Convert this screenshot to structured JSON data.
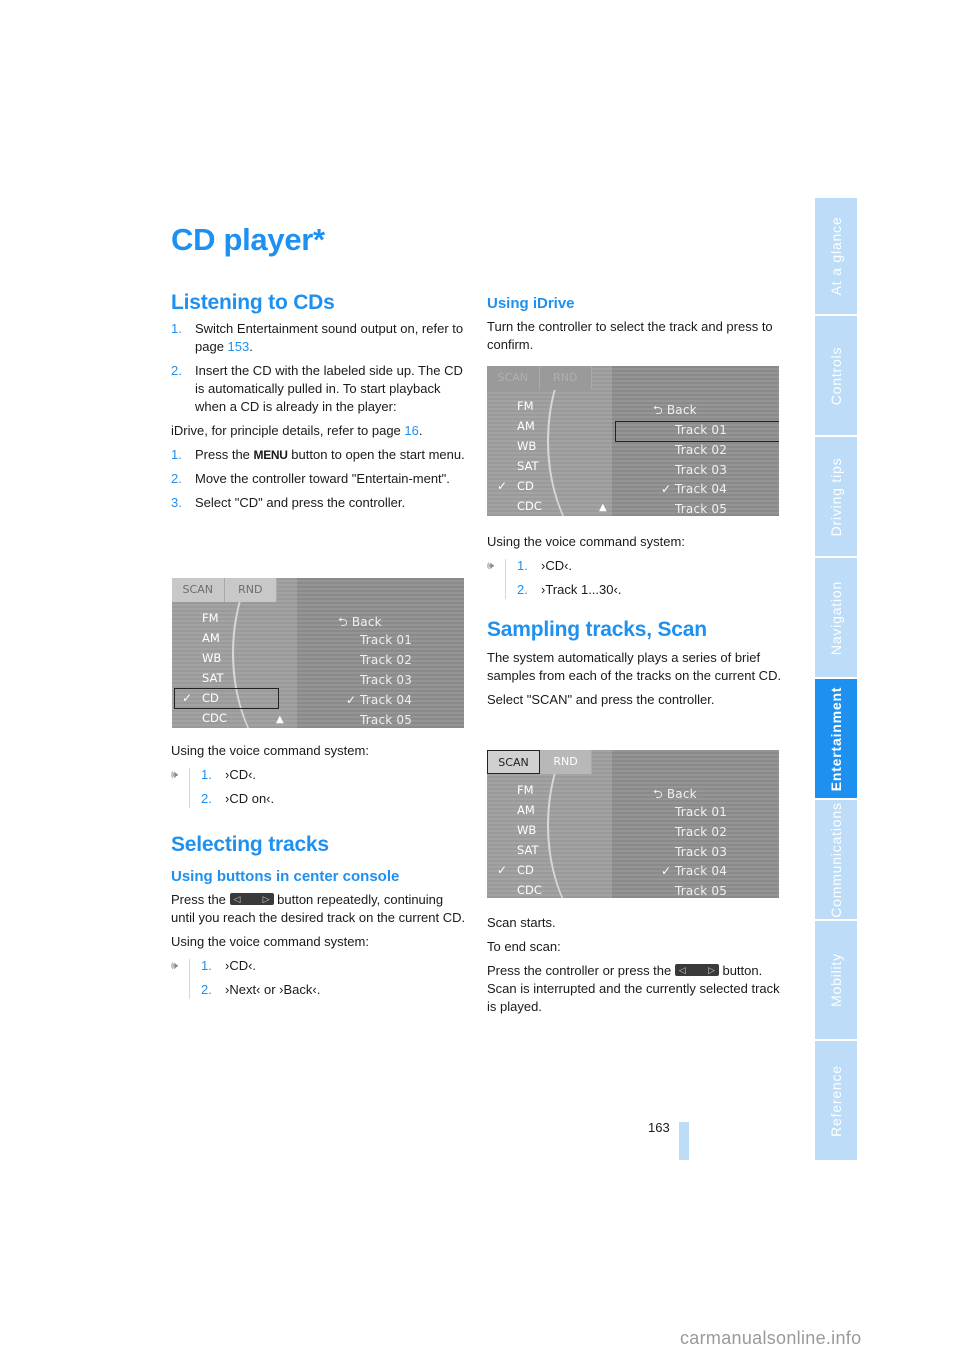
{
  "page": {
    "title": "CD player",
    "title_mark": "*",
    "page_number": "163",
    "watermark": "carmanualsonline.info"
  },
  "sidebar": {
    "tabs": [
      {
        "label": "At a glance",
        "active": false
      },
      {
        "label": "Controls",
        "active": false
      },
      {
        "label": "Driving tips",
        "active": false
      },
      {
        "label": "Navigation",
        "active": false
      },
      {
        "label": "Entertainment",
        "active": true
      },
      {
        "label": "Communications",
        "active": false
      },
      {
        "label": "Mobility",
        "active": false
      },
      {
        "label": "Reference",
        "active": false
      }
    ]
  },
  "listening": {
    "heading": "Listening to CDs",
    "steps1": [
      {
        "num": "1.",
        "text": "Switch Entertainment sound output on, refer to page ",
        "link": "153",
        "after": "."
      },
      {
        "num": "2.",
        "text": "Insert the CD with the labeled side up. The CD is automatically pulled in. To start playback when a CD is already in the player:"
      }
    ],
    "idrive_intro": "iDrive, for principle details, refer to page ",
    "idrive_link": "16",
    "idrive_after": ".",
    "steps2": [
      {
        "num": "1.",
        "pre": "Press the ",
        "button": "MENU",
        "post": " button to open the start menu."
      },
      {
        "num": "2.",
        "text": "Move the controller toward \"Entertain-ment\"."
      },
      {
        "num": "3.",
        "text": "Select \"CD\" and press the controller."
      }
    ],
    "voice_intro": "Using the voice command system:",
    "voice": [
      {
        "num": "1.",
        "text": "›CD‹."
      },
      {
        "num": "2.",
        "text": "›CD on‹."
      }
    ]
  },
  "screen": {
    "tabs": [
      "SCAN",
      "RND"
    ],
    "sources": [
      "FM",
      "AM",
      "WB",
      "SAT",
      "CD",
      "CDC"
    ],
    "selected_source": "CD",
    "back_label": "Back",
    "tracks": [
      "Track  01",
      "Track  02",
      "Track  03",
      "Track  04",
      "Track  05"
    ],
    "playing_track": "Track  04"
  },
  "selecting": {
    "heading": "Selecting tracks",
    "sub1": "Using buttons in center console",
    "buttons_text_pre": "Press the ",
    "buttons_text_post": " button repeatedly, continuing until you reach the desired track on the current CD.",
    "voice_intro": "Using the voice command system:",
    "voice": [
      {
        "num": "1.",
        "text": "›CD‹."
      },
      {
        "num": "2.",
        "text": "›Next‹ or ›Back‹."
      }
    ],
    "sub2": "Using iDrive",
    "idrive_text": "Turn the controller to select the track and press to confirm.",
    "voice2_intro": "Using the voice command system:",
    "voice2": [
      {
        "num": "1.",
        "text": "›CD‹."
      },
      {
        "num": "2.",
        "text": "›Track 1...30‹."
      }
    ]
  },
  "scan": {
    "heading": "Sampling tracks, Scan",
    "p1": "The system automatically plays a series of brief samples from each of the tracks on the current CD.",
    "p2": "Select \"SCAN\" and press the controller.",
    "p3": "Scan starts.",
    "p4": "To end scan:",
    "p5_pre": "Press the controller or press the ",
    "p5_post": " button. Scan is interrupted and the currently selected track is played."
  }
}
